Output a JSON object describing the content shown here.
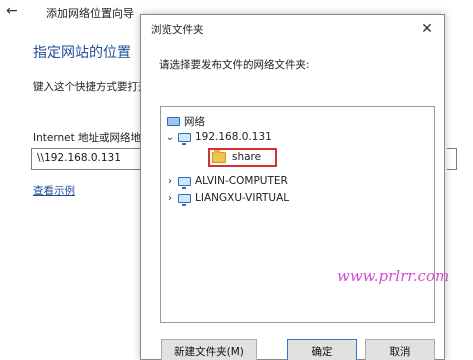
{
  "wizard": {
    "title": "添加网络位置向导",
    "heading": "指定网站的位置",
    "description": "键入这个快捷方式要打开的",
    "address_label": "Internet 地址或网络地址(",
    "address_value": "\\\\192.168.0.131",
    "examples_link": "查看示例"
  },
  "dialog": {
    "title": "浏览文件夹",
    "prompt": "请选择要发布文件的网络文件夹:",
    "tree": {
      "root": "网络",
      "host": "192.168.0.131",
      "share": "share",
      "computers": [
        "ALVIN-COMPUTER",
        "LIANGXU-VIRTUAL"
      ]
    },
    "buttons": {
      "new_folder": "新建文件夹(M)",
      "ok": "确定",
      "cancel": "取消"
    }
  },
  "watermark": "www.prlrr.com",
  "colors": {
    "highlight_box": "#d62f2f",
    "heading_blue": "#1f4e99",
    "watermark": "#d44bd4",
    "primary_border": "#2a78d4"
  },
  "icons": [
    "back-arrow-icon",
    "close-icon",
    "network-icon",
    "computer-icon",
    "folder-icon",
    "chevron-icon"
  ]
}
